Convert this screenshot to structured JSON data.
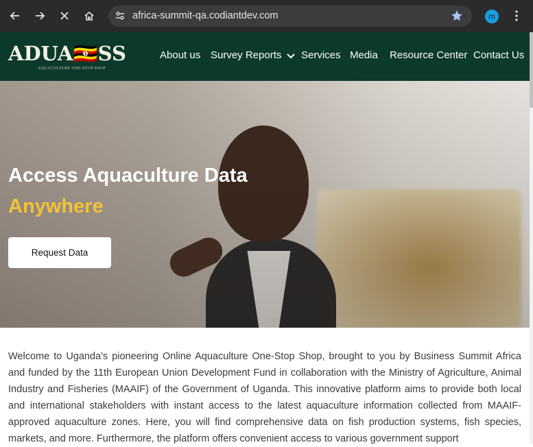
{
  "browser": {
    "url": "africa-summit-qa.codiantdev.com",
    "profile_initial": "m",
    "icons": {
      "back": "back-arrow-icon",
      "forward": "forward-arrow-icon",
      "stop": "close-icon",
      "home": "home-icon",
      "site_info": "tune-icon",
      "bookmark": "star-icon",
      "menu": "kebab-menu-icon"
    }
  },
  "site": {
    "logo": {
      "word": "ADUA🇺🇬SS",
      "tagline": "AQUACULTURE ONE-STOP SHOP"
    },
    "nav": [
      {
        "label": "About us"
      },
      {
        "label": "Survey Reports"
      },
      {
        "label": "Services"
      },
      {
        "label": "Media"
      },
      {
        "label": "Resource Center"
      },
      {
        "label": "Contact Us"
      }
    ]
  },
  "hero": {
    "title": "Access Aquaculture Data",
    "subtitle": "Anywhere",
    "cta_label": "Request Data"
  },
  "intro": {
    "text": "Welcome to Uganda's pioneering Online Aquaculture One-Stop Shop, brought to you by Business Summit Africa and funded by the 11th European Union Development Fund in collaboration with the Ministry of Agriculture, Animal Industry and Fisheries (MAAIF) of the Government of Uganda. This innovative platform aims to provide both local and international stakeholders with instant access to the latest aquaculture information collected from MAAIF-approved aquaculture zones. Here, you will find comprehensive data on fish production systems, fish species, markets, and more. Furthermore, the platform offers convenient access to various government support"
  },
  "colors": {
    "header_bg": "#0b3a2a",
    "accent_yellow": "#f3c233",
    "chrome_bg": "#2b2b2e"
  }
}
